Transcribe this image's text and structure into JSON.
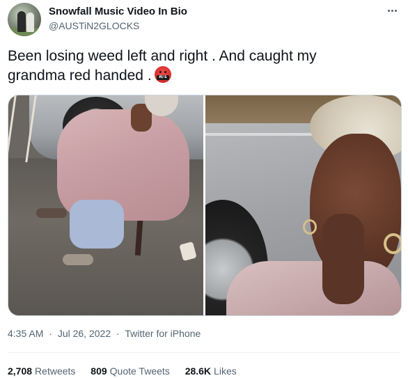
{
  "author": {
    "display_name": "Snowfall Music Video In Bio",
    "handle": "@AUSTiN2GLOCKS"
  },
  "tweet": {
    "text_line1": "Been losing weed left and right . And caught my",
    "text_line2": "grandma red handed .",
    "emoji_text": "#$!&",
    "emoji_name": "face-with-symbols-on-mouth"
  },
  "meta": {
    "time": "4:35 AM",
    "separator1": "·",
    "date": "Jul 26, 2022",
    "separator2": "·",
    "source": "Twitter for iPhone"
  },
  "stats": {
    "retweets_count": "2,708",
    "retweets_label": "Retweets",
    "quotes_count": "809",
    "quotes_label": "Quote Tweets",
    "likes_count": "28.6K",
    "likes_label": "Likes"
  },
  "icons": {
    "more": "more-horizontal-icon"
  },
  "colors": {
    "primary_text": "#0f1419",
    "secondary_text": "#536471",
    "border": "#cfd9de"
  }
}
